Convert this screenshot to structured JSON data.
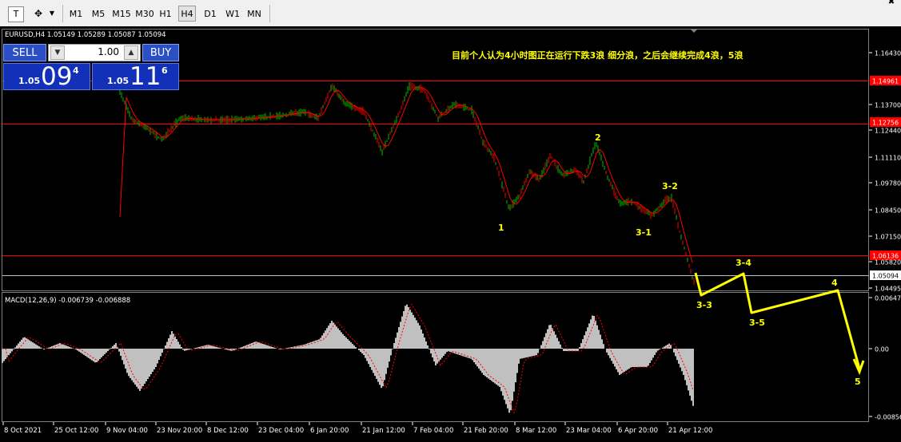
{
  "toolbar": {
    "cursor_icon": "text-cursor-icon",
    "draw_icon": "drawing-tools-icon",
    "timeframes": [
      "M1",
      "M5",
      "M15",
      "M30",
      "H1",
      "H4",
      "D1",
      "W1",
      "MN"
    ],
    "active_timeframe": "H4"
  },
  "chart": {
    "header": "EURUSD,H4  1.05149 1.05289 1.05087 1.05094",
    "annotation": "目前个人认为4小时图正在运行下跌3浪 细分浪，之后会继续完成4浪，5浪",
    "price_axis_labels": [
      "1.16430",
      "1.14961",
      "1.13700",
      "1.12756",
      "1.12440",
      "1.11110",
      "1.09780",
      "1.08450",
      "1.07150",
      "1.06136",
      "1.05820",
      "1.05094",
      "1.04495"
    ],
    "horizontal_lines": [
      {
        "label": "1.14961",
        "color": "#ff0000"
      },
      {
        "label": "1.12756",
        "color": "#ff0000"
      },
      {
        "label": "1.06136",
        "color": "#ff0000"
      },
      {
        "label": "1.05094",
        "color": "#c0c0c0"
      }
    ],
    "date_axis_labels": [
      "8 Oct 2021",
      "25 Oct 12:00",
      "9 Nov 04:00",
      "23 Nov 20:00",
      "8 Dec 12:00",
      "23 Dec 04:00",
      "6 Jan 20:00",
      "21 Jan 12:00",
      "7 Feb 04:00",
      "21 Feb 20:00",
      "8 Mar 12:00",
      "23 Mar 04:00",
      "6 Apr 20:00",
      "21 Apr 12:00"
    ],
    "wave_labels": [
      "1",
      "2",
      "3-1",
      "3-2",
      "3-3",
      "3-4",
      "3-5",
      "4",
      "5"
    ],
    "colors": {
      "bull": "#00c000",
      "bear": "#ff0000",
      "ma": "#ff0000",
      "wave": "#ffff00",
      "grid_text": "#ffffff",
      "histogram": "#c0c0c0"
    }
  },
  "macd": {
    "header": "MACD(12,26,9) -0.006739 -0.006888",
    "axis_labels": [
      "0.006472",
      "0.00",
      "-0.008568"
    ]
  },
  "trade_panel": {
    "sell_label": "SELL",
    "buy_label": "BUY",
    "lot_value": "1.00",
    "bid_small": "1.05",
    "bid_big": "09",
    "bid_sup": "4",
    "ask_small": "1.05",
    "ask_big": "11",
    "ask_sup": "6"
  }
}
